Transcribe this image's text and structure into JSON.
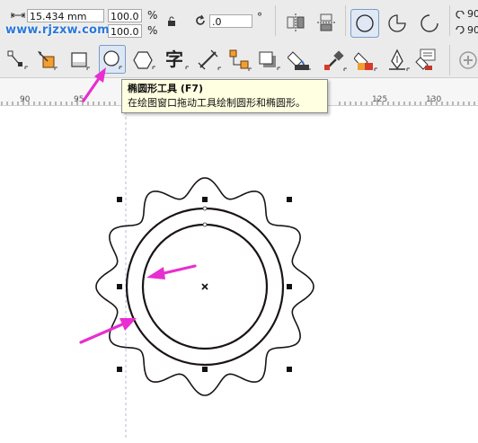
{
  "property_bar": {
    "width_value": "15.434 mm",
    "scale_x": "100.0",
    "scale_y": "100.0",
    "percent_symbol": "%",
    "rotation_value": ".0",
    "degree_symbol": "°",
    "right_cut_1": "90",
    "right_cut_2": "90"
  },
  "watermark": "www.rjzxw.com",
  "ruler": {
    "ticks": [
      "90",
      "95",
      "125",
      "130"
    ]
  },
  "tooltip": {
    "title": "椭圆形工具 (F7)",
    "description": "在绘图窗口拖动工具绘制圆形和椭圆形。"
  },
  "toolbox": {
    "icons": [
      "pick-icon",
      "shape-icon",
      "rectangle-icon",
      "ellipse-icon",
      "polygon-icon",
      "text-icon",
      "dimension-icon",
      "connector-icon",
      "drop-shadow-icon",
      "fill-icon",
      "eyedropper-icon",
      "interactive-fill-icon",
      "pen-icon",
      "smart-fill-icon",
      "add-icon"
    ]
  },
  "colors": {
    "annotation_arrow": "#e82ed0",
    "shape_stroke": "#1a1416",
    "tooltip_bg": "#ffffe1",
    "watermark": "#2a78d8"
  }
}
